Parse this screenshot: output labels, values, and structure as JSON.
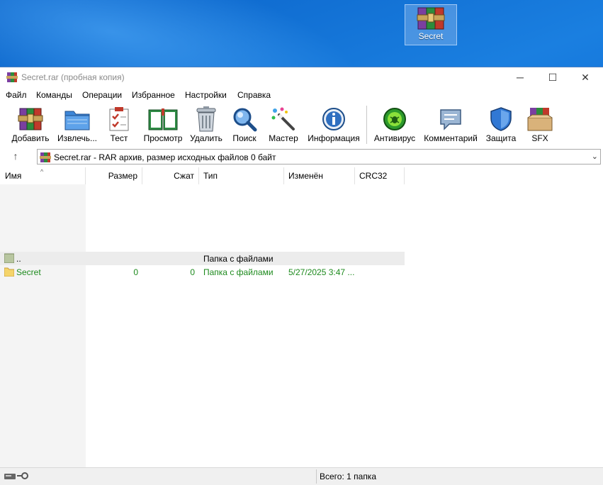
{
  "desktop": {
    "icon_label": "Secret"
  },
  "window": {
    "title": "Secret.rar (пробная копия)",
    "controls": {
      "minimize": "─",
      "maximize": "☐",
      "close": "✕"
    }
  },
  "menu": [
    "Файл",
    "Команды",
    "Операции",
    "Избранное",
    "Настройки",
    "Справка"
  ],
  "toolbar": [
    {
      "label": "Добавить",
      "icon": "winrar-books-icon"
    },
    {
      "label": "Извлечь...",
      "icon": "extract-folder-icon"
    },
    {
      "label": "Тест",
      "icon": "test-clipboard-icon"
    },
    {
      "label": "Просмотр",
      "icon": "view-book-icon"
    },
    {
      "label": "Удалить",
      "icon": "trash-icon"
    },
    {
      "label": "Поиск",
      "icon": "magnifier-icon"
    },
    {
      "label": "Мастер",
      "icon": "wizard-wand-icon"
    },
    {
      "label": "Информация",
      "icon": "info-icon"
    },
    {
      "label": "Антивирус",
      "icon": "antivirus-bug-icon"
    },
    {
      "label": "Комментарий",
      "icon": "comment-icon"
    },
    {
      "label": "Защита",
      "icon": "shield-icon"
    },
    {
      "label": "SFX",
      "icon": "sfx-box-icon"
    }
  ],
  "address": {
    "up_arrow": "↑",
    "text": "Secret.rar - RAR архив, размер исходных файлов 0 байт",
    "chevron": "⌄"
  },
  "columns": [
    "Имя",
    "Размер",
    "Сжат",
    "Тип",
    "Изменён",
    "CRC32"
  ],
  "rows": [
    {
      "name": "..",
      "size": "",
      "packed": "",
      "type": "Папка с файлами",
      "modified": "",
      "crc": ""
    },
    {
      "name": "Secret",
      "size": "0",
      "packed": "0",
      "type": "Папка с файлами",
      "modified": "5/27/2025 3:47 ...",
      "crc": ""
    }
  ],
  "status": {
    "total": "Всего: 1 папка"
  },
  "colors": {
    "accent_green": "#1d8a1d",
    "desktop_blue": "#0d6ad6"
  }
}
